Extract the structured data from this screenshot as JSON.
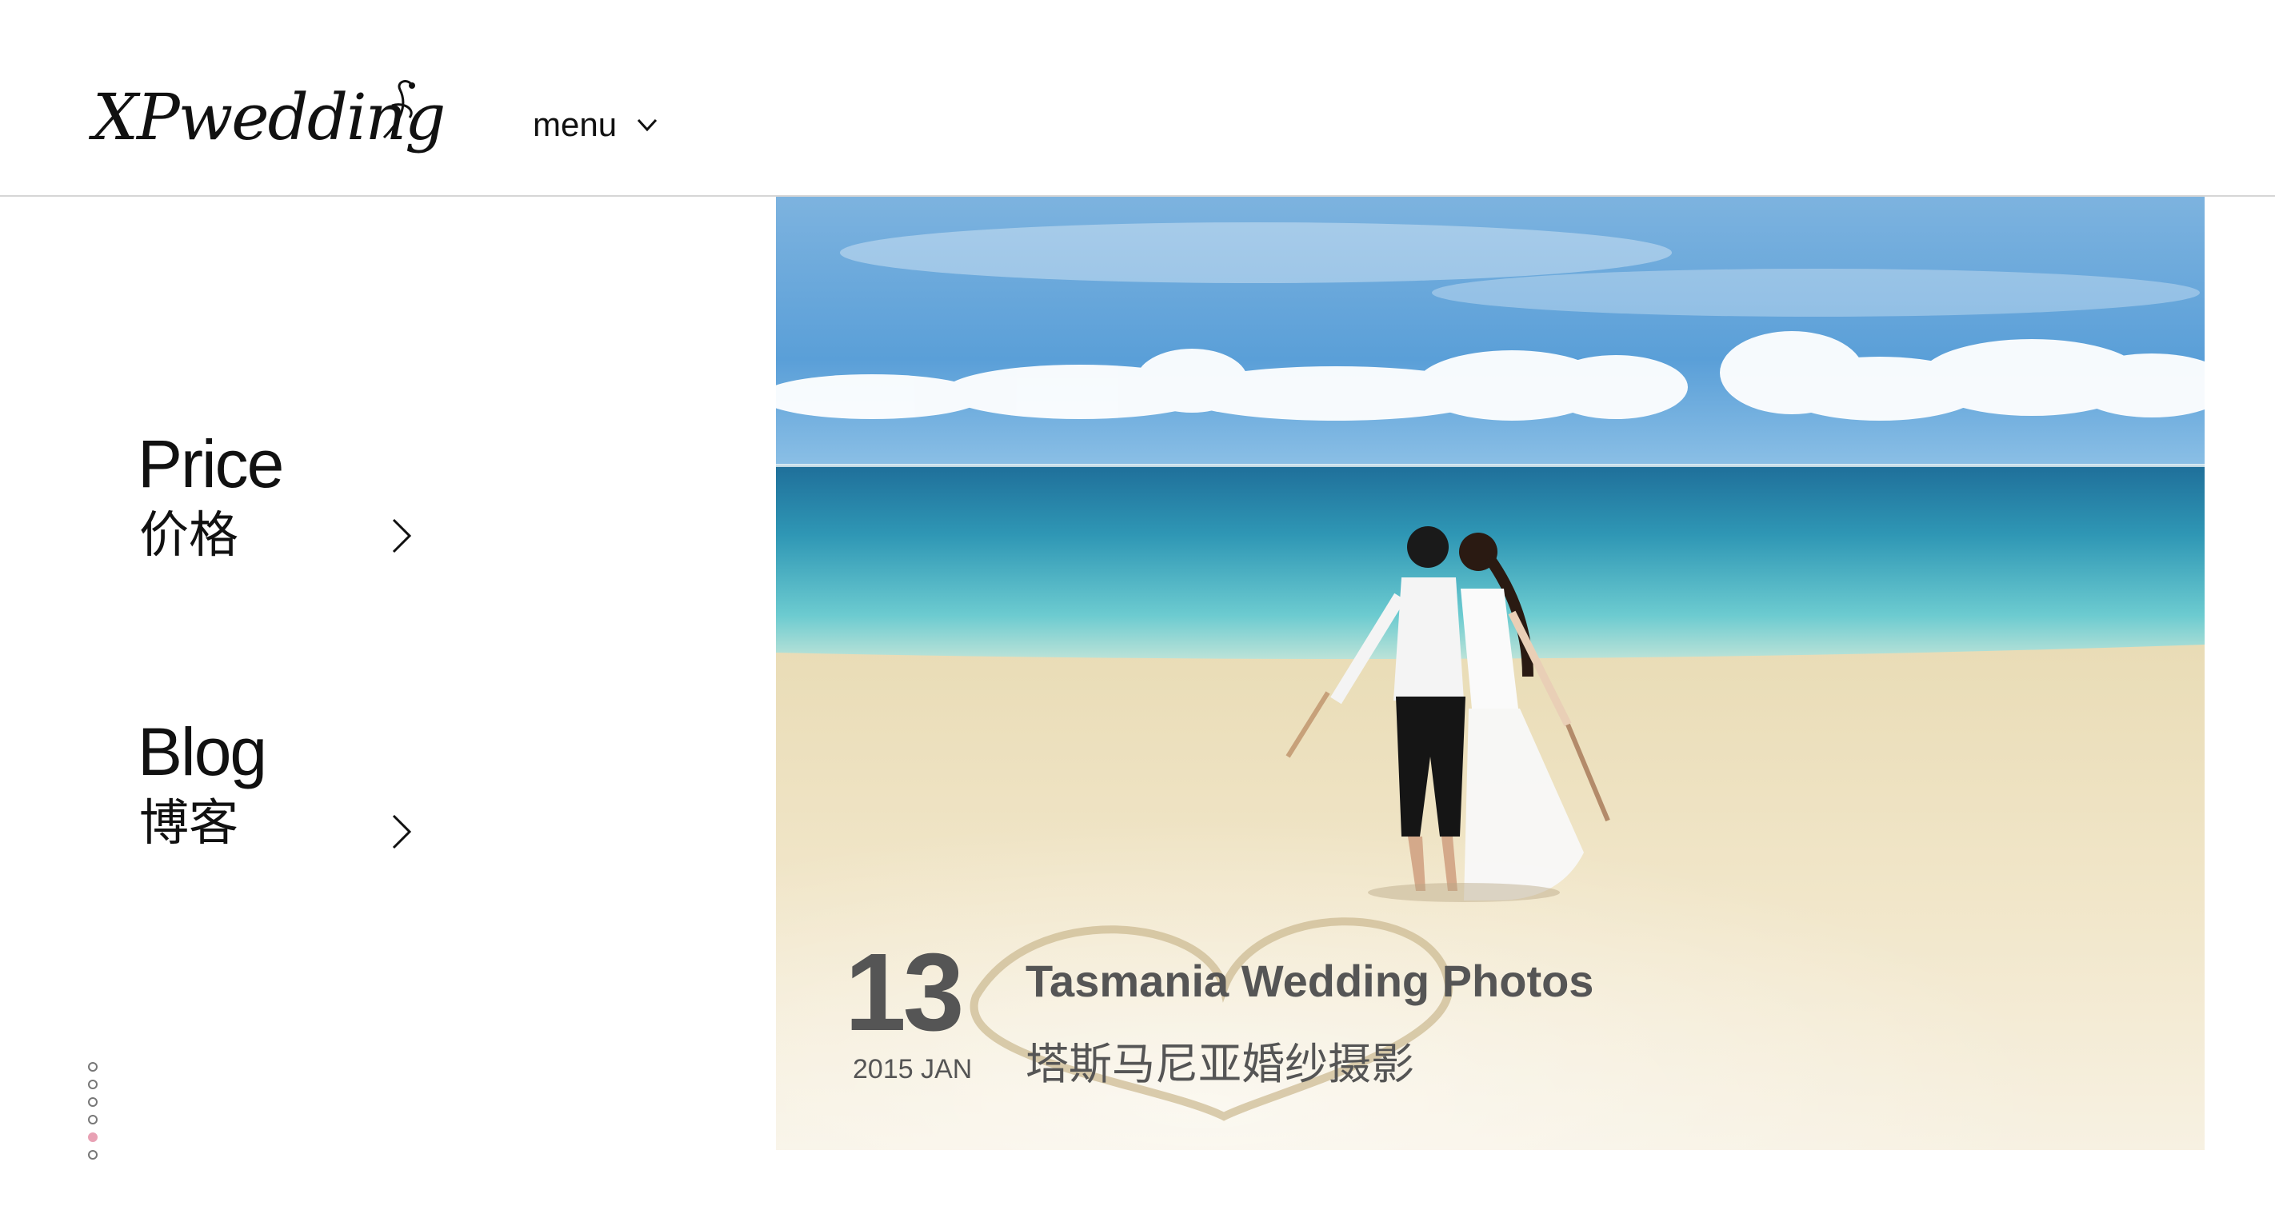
{
  "header": {
    "logo_text": "XPwedding",
    "menu_label": "menu",
    "menu_icon": "chevron-down-icon"
  },
  "nav": {
    "items": [
      {
        "label_en": "Price",
        "label_zh": "价格",
        "icon": "chevron-right-icon"
      },
      {
        "label_en": "Blog",
        "label_zh": "博客",
        "icon": "chevron-right-icon"
      }
    ]
  },
  "pager": {
    "count": 6,
    "active_index": 4,
    "active_color": "#e8a1b4"
  },
  "featured_post": {
    "day": "13",
    "year_month": "2015 JAN",
    "title": "Tasmania Wedding Photos",
    "title_zh": "塔斯马尼亚婚纱摄影",
    "text_color": "#555555"
  },
  "colors": {
    "sky_top": "#5a9fd8",
    "sea": "#3fb3c3",
    "sand": "#f1e6c9"
  }
}
